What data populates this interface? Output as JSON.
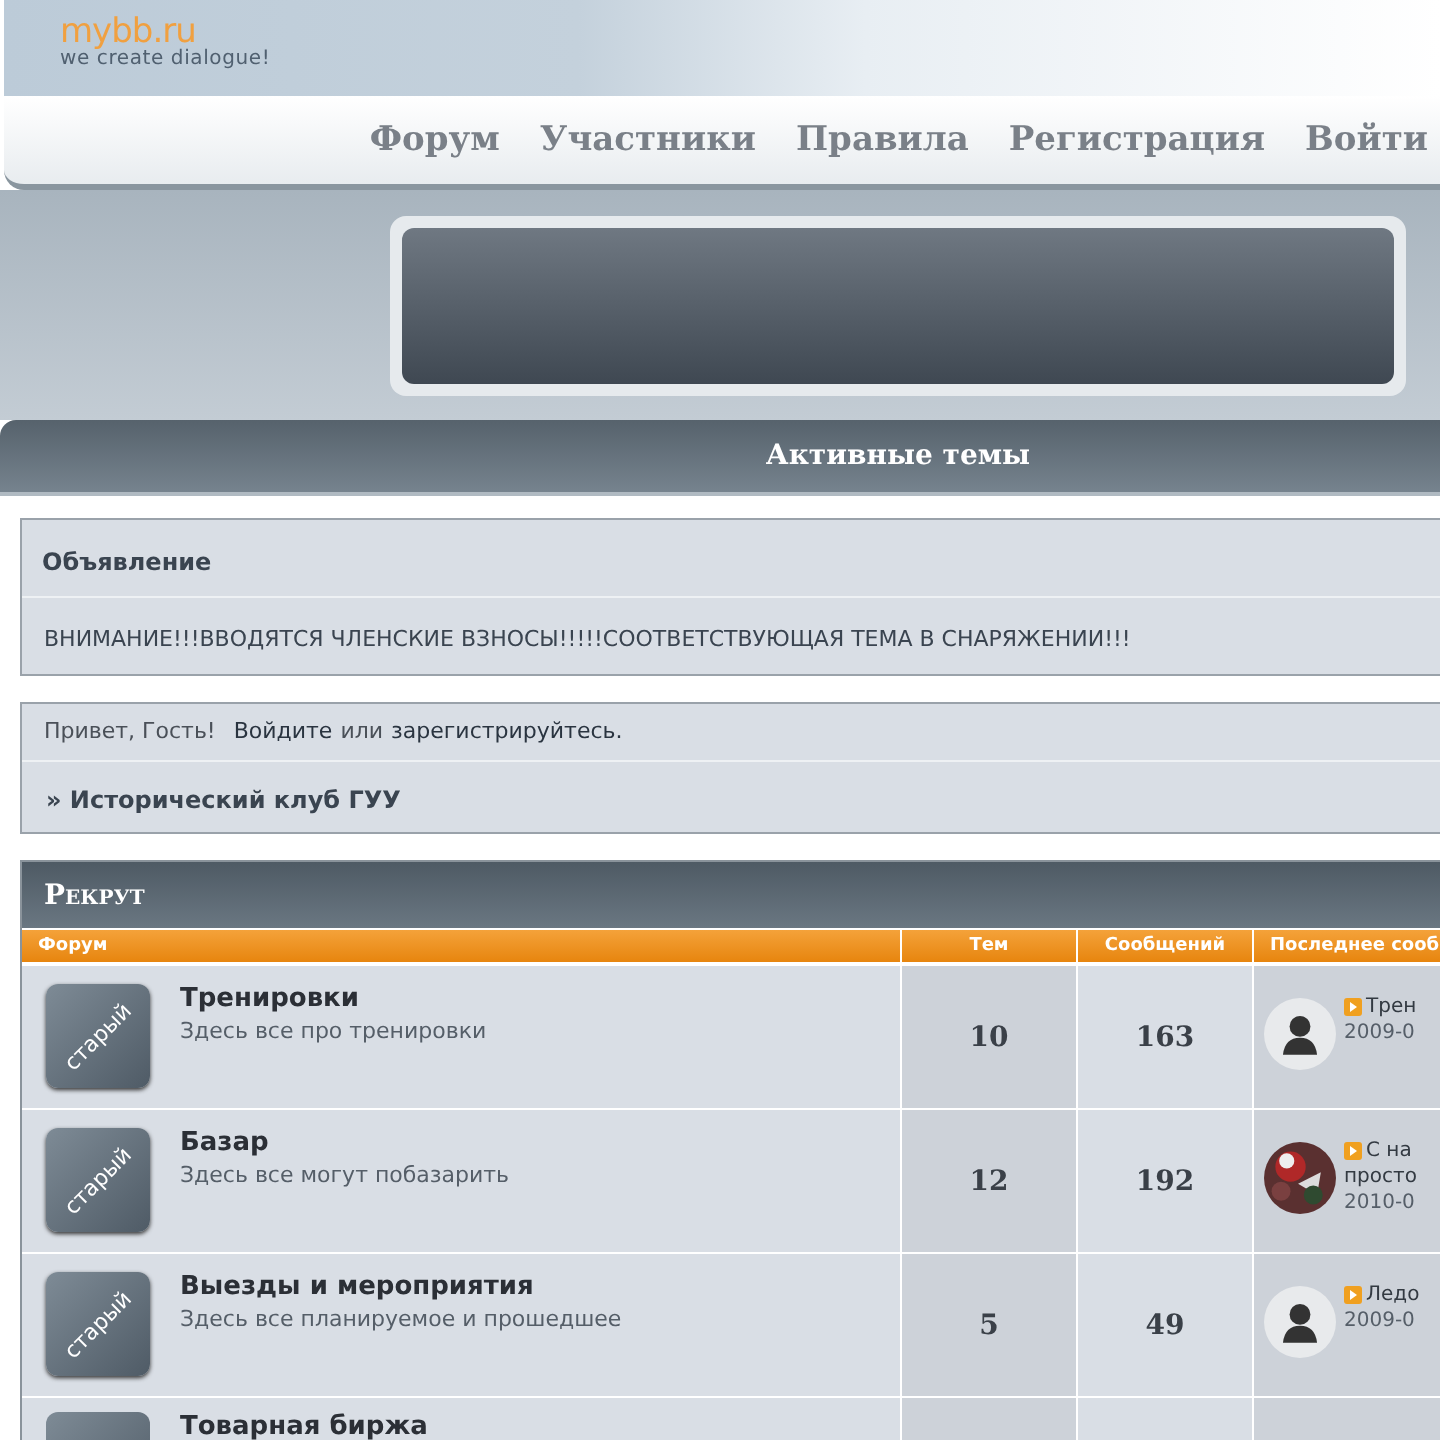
{
  "logo": {
    "name": "mybb.ru",
    "tagline": "we create dialogue!"
  },
  "nav": [
    "Форум",
    "Участники",
    "Правила",
    "Регистрация",
    "Войти"
  ],
  "title_bar": "Активные темы",
  "announcement": {
    "title": "Объявление",
    "text": "ВНИМАНИЕ!!!ВВОДЯТСЯ ЧЛЕНСКИЕ ВЗНОСЫ!!!!!СООТВЕТСТВУЮЩАЯ ТЕМА В СНАРЯЖЕНИИ!!!"
  },
  "welcome": {
    "greeting": "Привет, Гость!",
    "login": "Войдите",
    "or": "или",
    "register": "зарегистрируйтесь.",
    "crumb": "» Исторический клуб ГУУ"
  },
  "category": {
    "title": "Рекрут",
    "columns": [
      "Форум",
      "Тем",
      "Сообщений",
      "Последнее сооб"
    ],
    "rows": [
      {
        "badge": "старый",
        "title": "Тренировки",
        "description": "Здесь все про тренировки",
        "topics": "10",
        "posts": "163",
        "avatar": {
          "kind": "silhouette"
        },
        "last_post": [
          "Трен"
        ],
        "date": "2009-0"
      },
      {
        "badge": "старый",
        "title": "Базар",
        "description": "Здесь все могут побазарить",
        "topics": "12",
        "posts": "192",
        "last_post": [
          "С на",
          "просто"
        ],
        "date": "2010-0"
      },
      {
        "badge": "старый",
        "title": "Выезды и мероприятия",
        "description": "Здесь все планируемое и прошедшее",
        "topics": "5",
        "posts": "49",
        "avatar": {
          "kind": "silhouette"
        },
        "last_post": [
          "Ледо"
        ],
        "date": "2009-0"
      },
      {
        "title": "Товарная биржа"
      }
    ]
  }
}
